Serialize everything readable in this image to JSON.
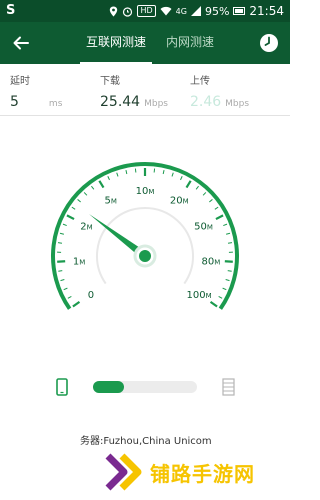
{
  "status_bar": {
    "left_glyph": "S",
    "hd_label": "HD",
    "network_label": "4G",
    "battery": "95%",
    "time": "21:54"
  },
  "header": {
    "tabs": [
      {
        "label": "互联网测速",
        "active": true
      },
      {
        "label": "内网测速",
        "active": false
      }
    ]
  },
  "stats": {
    "latency": {
      "label": "延时",
      "value": "5",
      "unit": "ms"
    },
    "download": {
      "label": "下载",
      "value": "25.44",
      "unit": "Mbps"
    },
    "upload": {
      "label": "上传",
      "value": "2.46",
      "unit": "Mbps"
    }
  },
  "gauge": {
    "ticks": [
      {
        "num": "0",
        "unit": ""
      },
      {
        "num": "1",
        "unit": "M"
      },
      {
        "num": "2",
        "unit": "M"
      },
      {
        "num": "5",
        "unit": "M"
      },
      {
        "num": "10",
        "unit": "M"
      },
      {
        "num": "20",
        "unit": "M"
      },
      {
        "num": "50",
        "unit": "M"
      },
      {
        "num": "80",
        "unit": "M"
      },
      {
        "num": "100",
        "unit": "M"
      }
    ],
    "needle_tick_position": 2.3
  },
  "progress": {
    "fraction": 0.3
  },
  "server_info": {
    "text": "务器:Fuzhou,China Unicom"
  },
  "watermark": {
    "text": "铺路手游网"
  },
  "colors": {
    "brand_dark": "#0b4d2a",
    "brand": "#0e5b32",
    "accent": "#1b9a4e",
    "watermark_yellow": "#f6c400",
    "watermark_purple": "#7a2a90"
  },
  "icons": {
    "back": "arrow-left-icon",
    "history": "clock-icon",
    "phone": "phone-icon",
    "server": "server-icon"
  }
}
